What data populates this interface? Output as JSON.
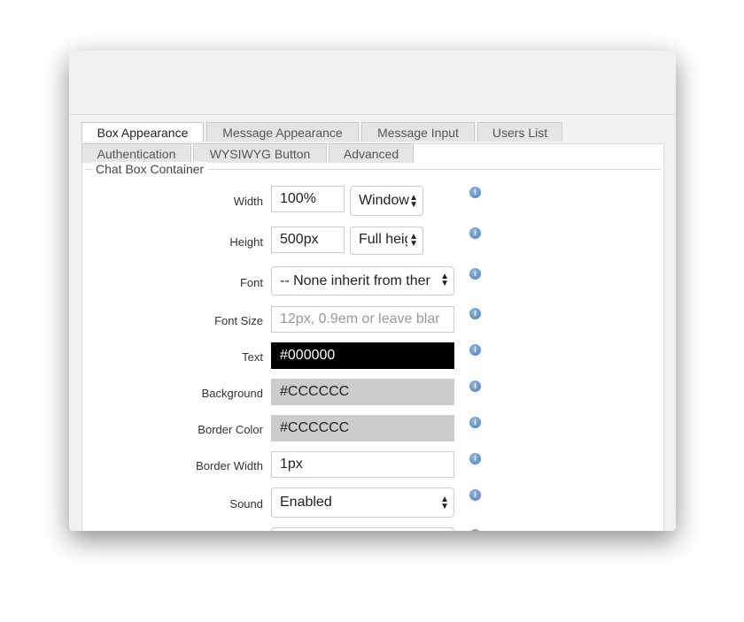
{
  "tabs_row1": [
    "Box Appearance",
    "Message Appearance",
    "Message Input",
    "Users List"
  ],
  "tabs_row2": [
    "Authentication",
    "WYSIWYG Button",
    "Advanced"
  ],
  "section_title": "Chat Box Container",
  "fields": {
    "width": {
      "label": "Width",
      "value": "100%",
      "unit": "Window"
    },
    "height": {
      "label": "Height",
      "value": "500px",
      "unit": "Full heig"
    },
    "font": {
      "label": "Font",
      "value": "-- None inherit from ther"
    },
    "font_size": {
      "label": "Font Size",
      "placeholder": "12px, 0.9em or leave blar"
    },
    "text": {
      "label": "Text",
      "value": "#000000",
      "color": "#000000"
    },
    "background": {
      "label": "Background",
      "value": "#CCCCCC",
      "color": "#CCCCCC"
    },
    "border_color": {
      "label": "Border Color",
      "value": "#CCCCCC",
      "color": "#CCCCCC"
    },
    "border_width": {
      "label": "Border Width",
      "value": "1px"
    },
    "sound": {
      "label": "Sound",
      "value": "Enabled"
    }
  },
  "info_icon": "info-icon"
}
